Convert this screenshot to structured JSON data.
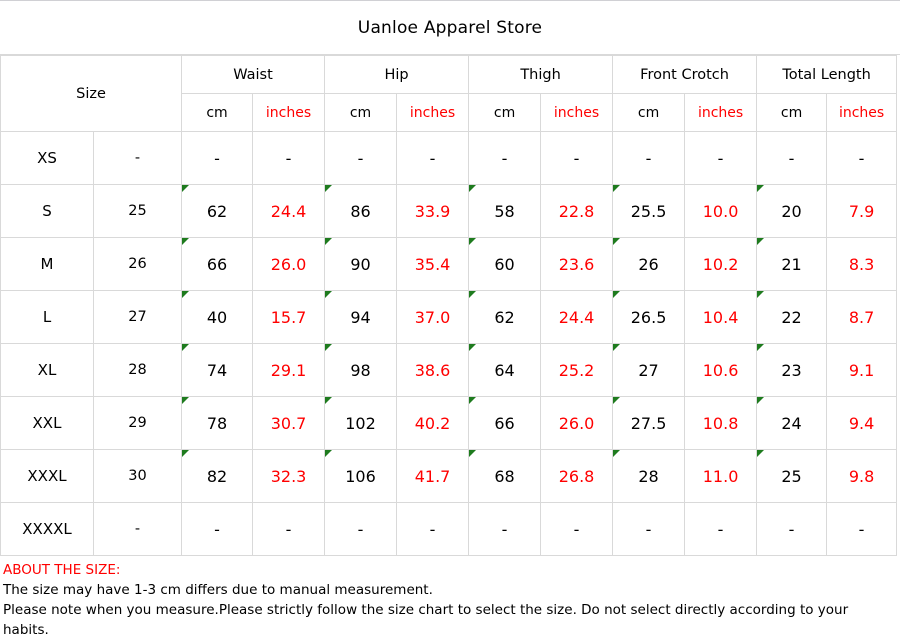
{
  "title": "Uanloe Apparel Store",
  "colors": {
    "inches_text": "#ff0000",
    "cm_text": "#000000",
    "note_heading": "#ff0000",
    "grid_line": "#d9d9d9",
    "comment_marker": "#1e7b1e"
  },
  "table": {
    "size_header": "Size",
    "measurement_groups": [
      "Waist",
      "Hip",
      "Thigh",
      "Front Crotch",
      "Total Length"
    ],
    "unit_headers": [
      "cm",
      "inches"
    ],
    "units_row": [
      "cm",
      "inches",
      "cm",
      "inches",
      "cm",
      "inches",
      "cm",
      "inches",
      "cm",
      "inches"
    ],
    "rows": [
      {
        "size": "XS",
        "size_number": "-",
        "waist_cm": "-",
        "waist_in": "-",
        "hip_cm": "-",
        "hip_in": "-",
        "thigh_cm": "-",
        "thigh_in": "-",
        "front_crotch_cm": "-",
        "front_crotch_in": "-",
        "total_length_cm": "-",
        "total_length_in": "-",
        "has_markers": false
      },
      {
        "size": "S",
        "size_number": "25",
        "waist_cm": "62",
        "waist_in": "24.4",
        "hip_cm": "86",
        "hip_in": "33.9",
        "thigh_cm": "58",
        "thigh_in": "22.8",
        "front_crotch_cm": "25.5",
        "front_crotch_in": "10.0",
        "total_length_cm": "20",
        "total_length_in": "7.9",
        "has_markers": true
      },
      {
        "size": "M",
        "size_number": "26",
        "waist_cm": "66",
        "waist_in": "26.0",
        "hip_cm": "90",
        "hip_in": "35.4",
        "thigh_cm": "60",
        "thigh_in": "23.6",
        "front_crotch_cm": "26",
        "front_crotch_in": "10.2",
        "total_length_cm": "21",
        "total_length_in": "8.3",
        "has_markers": true
      },
      {
        "size": "L",
        "size_number": "27",
        "waist_cm": "40",
        "waist_in": "15.7",
        "hip_cm": "94",
        "hip_in": "37.0",
        "thigh_cm": "62",
        "thigh_in": "24.4",
        "front_crotch_cm": "26.5",
        "front_crotch_in": "10.4",
        "total_length_cm": "22",
        "total_length_in": "8.7",
        "has_markers": true
      },
      {
        "size": "XL",
        "size_number": "28",
        "waist_cm": "74",
        "waist_in": "29.1",
        "hip_cm": "98",
        "hip_in": "38.6",
        "thigh_cm": "64",
        "thigh_in": "25.2",
        "front_crotch_cm": "27",
        "front_crotch_in": "10.6",
        "total_length_cm": "23",
        "total_length_in": "9.1",
        "has_markers": true
      },
      {
        "size": "XXL",
        "size_number": "29",
        "waist_cm": "78",
        "waist_in": "30.7",
        "hip_cm": "102",
        "hip_in": "40.2",
        "thigh_cm": "66",
        "thigh_in": "26.0",
        "front_crotch_cm": "27.5",
        "front_crotch_in": "10.8",
        "total_length_cm": "24",
        "total_length_in": "9.4",
        "has_markers": true
      },
      {
        "size": "XXXL",
        "size_number": "30",
        "waist_cm": "82",
        "waist_in": "32.3",
        "hip_cm": "106",
        "hip_in": "41.7",
        "thigh_cm": "68",
        "thigh_in": "26.8",
        "front_crotch_cm": "28",
        "front_crotch_in": "11.0",
        "total_length_cm": "25",
        "total_length_in": "9.8",
        "has_markers": true
      },
      {
        "size": "XXXXL",
        "size_number": "-",
        "waist_cm": "-",
        "waist_in": "-",
        "hip_cm": "-",
        "hip_in": "-",
        "thigh_cm": "-",
        "thigh_in": "-",
        "front_crotch_cm": "-",
        "front_crotch_in": "-",
        "total_length_cm": "-",
        "total_length_in": "-",
        "has_markers": false
      }
    ]
  },
  "notes": {
    "heading": "ABOUT THE SIZE:",
    "line1": "The size may have 1-3 cm differs due to manual measurement.",
    "line2": "Please note when you measure.Please strictly follow the size chart  to select the size. Do not select directly according to your habits."
  }
}
